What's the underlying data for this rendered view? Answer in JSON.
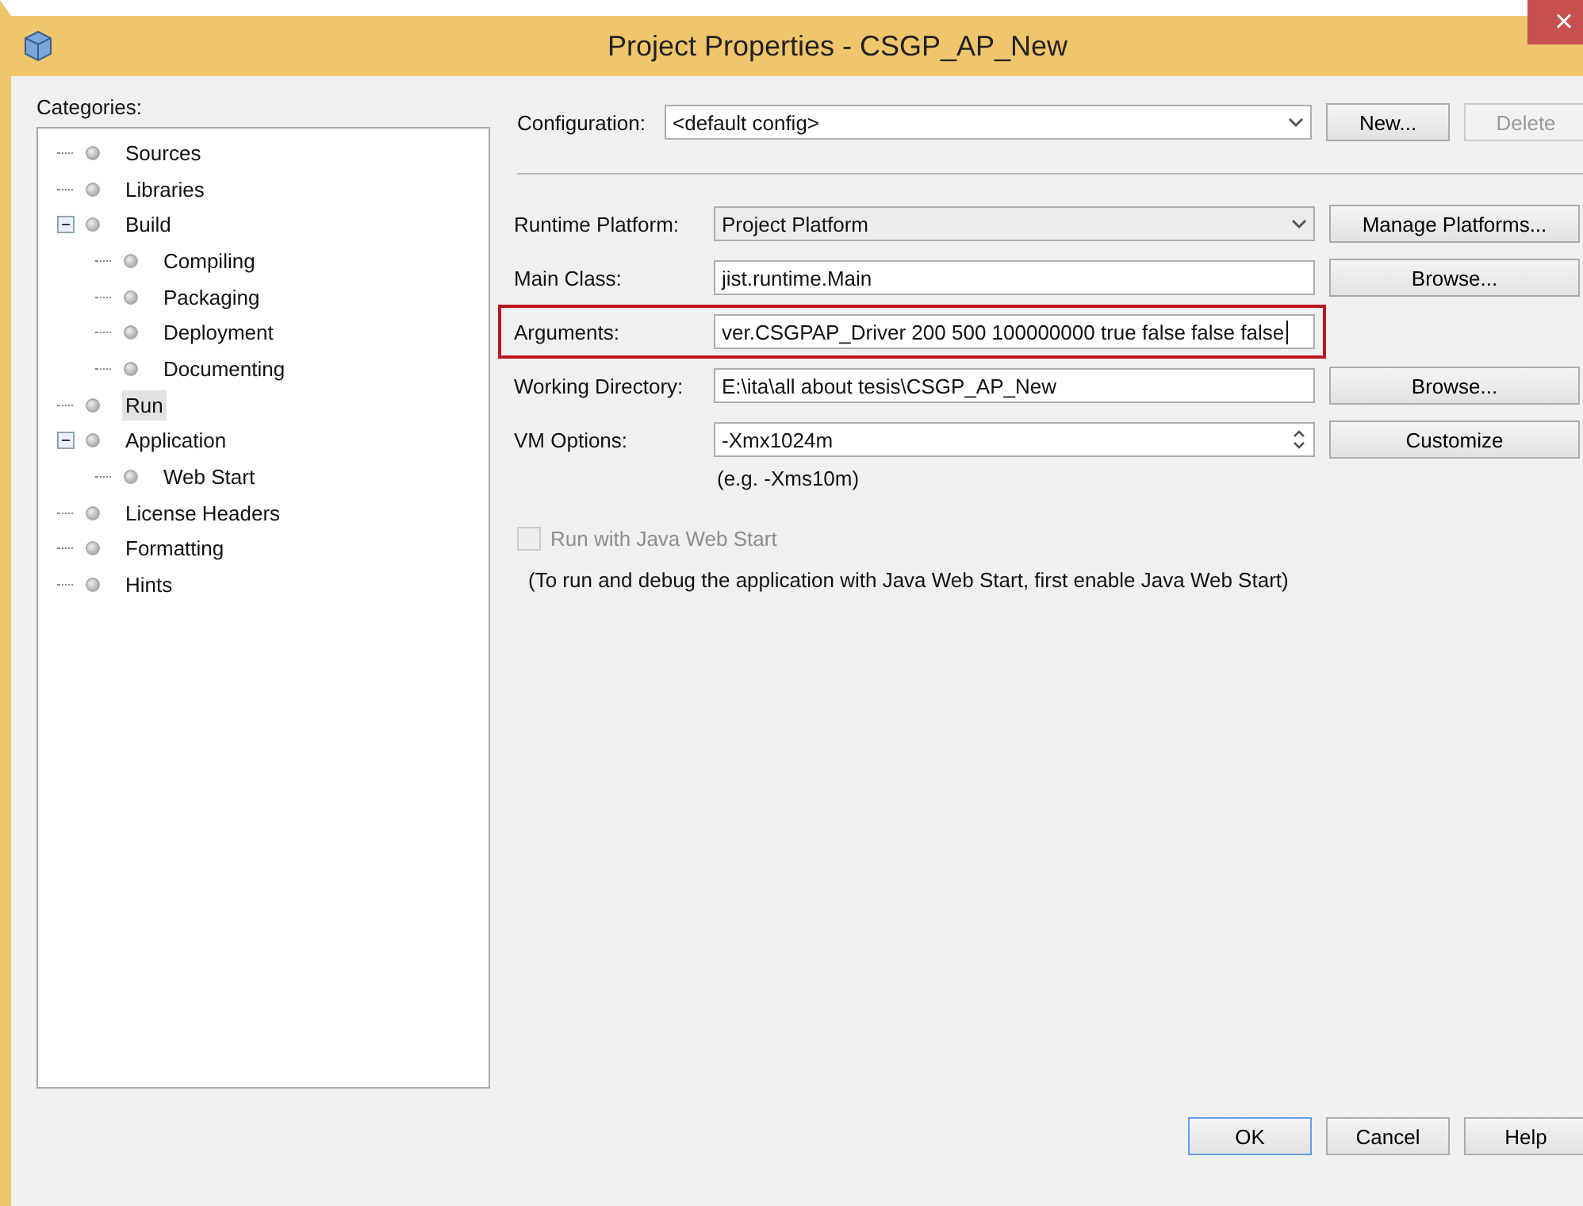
{
  "window": {
    "title": "Project Properties - CSGP_AP_New",
    "close": "×"
  },
  "categories": {
    "label": "Categories:",
    "items": [
      {
        "label": "Sources",
        "selected": false
      },
      {
        "label": "Libraries",
        "selected": false
      },
      {
        "label": "Build",
        "selected": false,
        "expanded": true,
        "children": [
          {
            "label": "Compiling",
            "selected": false
          },
          {
            "label": "Packaging",
            "selected": false
          },
          {
            "label": "Deployment",
            "selected": false
          },
          {
            "label": "Documenting",
            "selected": false
          }
        ]
      },
      {
        "label": "Run",
        "selected": true
      },
      {
        "label": "Application",
        "selected": false,
        "expanded": true,
        "children": [
          {
            "label": "Web Start",
            "selected": false
          }
        ]
      },
      {
        "label": "License Headers",
        "selected": false
      },
      {
        "label": "Formatting",
        "selected": false
      },
      {
        "label": "Hints",
        "selected": false
      }
    ]
  },
  "configuration": {
    "label": "Configuration:",
    "value": "<default config>",
    "buttons": [
      {
        "label": "New...",
        "disabled": false
      },
      {
        "label": "Delete",
        "disabled": true
      }
    ]
  },
  "fields": [
    {
      "kind": "combo",
      "label": "Runtime Platform:",
      "value": "Project Platform",
      "highlighted": false,
      "button": "Manage Platforms..."
    },
    {
      "kind": "text",
      "label": "Main Class:",
      "value": "jist.runtime.Main",
      "highlighted": false,
      "button": "Browse..."
    },
    {
      "kind": "text",
      "label": "Arguments:",
      "value": "ver.CSGPAP_Driver 200 500 100000000   true false false false",
      "highlighted": true
    },
    {
      "kind": "text",
      "label": "Working Directory:",
      "value": "E:\\ita\\all about tesis\\CSGP_AP_New",
      "highlighted": false,
      "button": "Browse..."
    },
    {
      "kind": "spinner",
      "label": "VM Options:",
      "value": "-Xmx1024m",
      "highlighted": false,
      "button": "Customize",
      "hint": "(e.g. -Xms10m)"
    }
  ],
  "web_start": {
    "label": "Run with Java Web Start",
    "checked": false,
    "disabled": true,
    "note": "(To run and debug the application with Java Web Start, first enable Java Web Start)"
  },
  "footer_buttons": [
    {
      "label": "OK",
      "default": true
    },
    {
      "label": "Cancel",
      "default": false
    },
    {
      "label": "Help",
      "default": false
    }
  ]
}
